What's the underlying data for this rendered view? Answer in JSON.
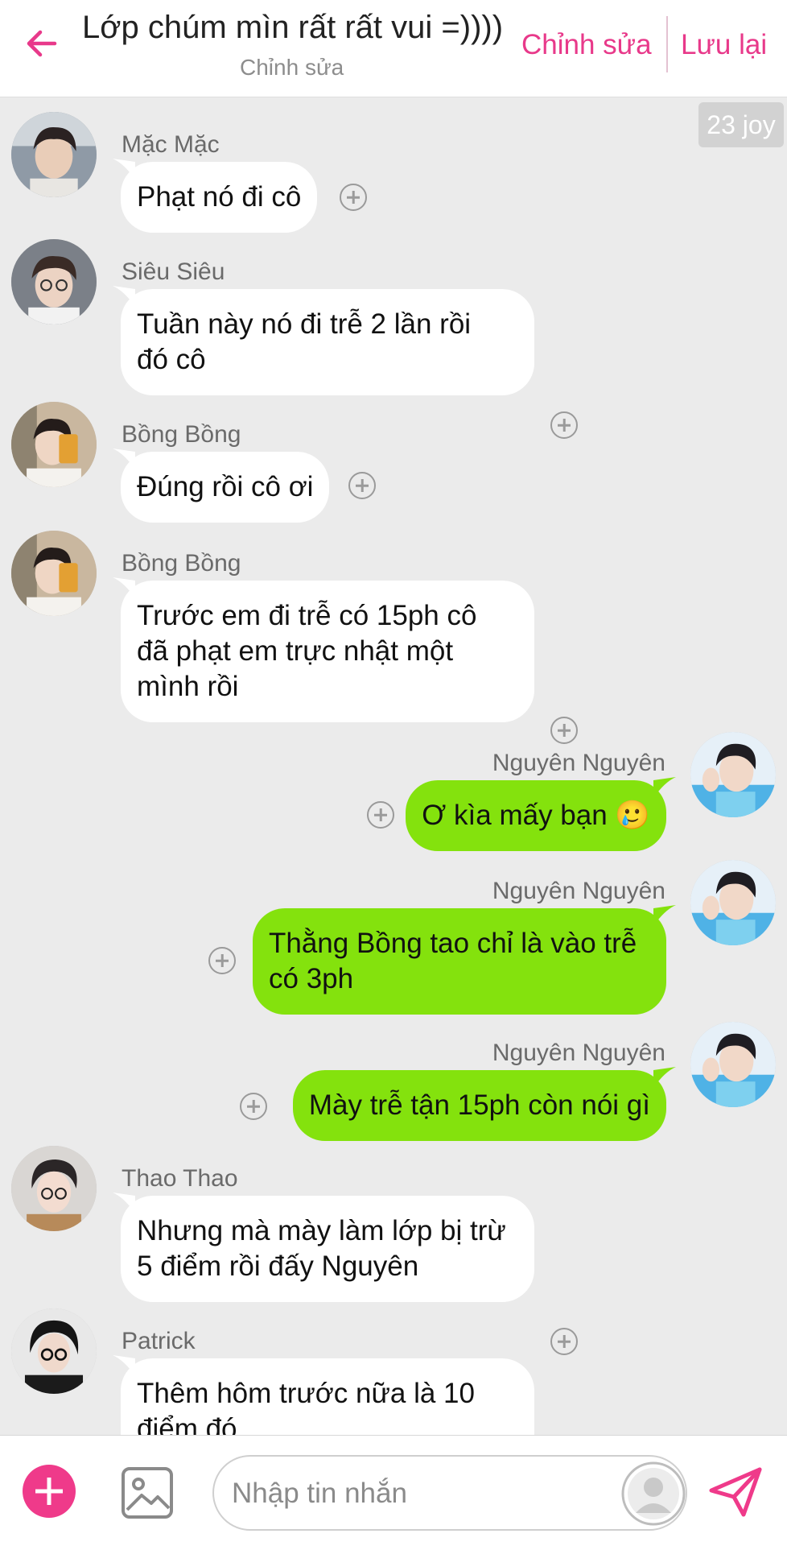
{
  "header": {
    "title": "Lớp chúm mìn rất rất vui =))))",
    "subtitle": "Chỉnh sửa",
    "edit_label": "Chỉnh sửa",
    "save_label": "Lưu lại",
    "accent_color": "#e8398a"
  },
  "chat": {
    "time_badge": "23 joy",
    "messages": [
      {
        "sender": "Mặc Mặc",
        "direction": "incoming",
        "lines": [
          "Phạt nó đi cô"
        ]
      },
      {
        "sender": "Siêu Siêu",
        "direction": "incoming",
        "lines": [
          "Tuần này nó đi trễ 2 lần rồi",
          "đó cô"
        ]
      },
      {
        "sender": "Bồng Bồng",
        "direction": "incoming",
        "lines": [
          "Đúng rồi cô ơi"
        ]
      },
      {
        "sender": "Bồng Bồng",
        "direction": "incoming",
        "lines": [
          "Trước em đi trễ có 15ph cô",
          "đã phạt em trực nhật một",
          "mình rồi"
        ]
      },
      {
        "sender": "Nguyên Nguyên",
        "direction": "outgoing",
        "lines": [
          "Ơ kìa mấy bạn 🥲"
        ]
      },
      {
        "sender": "Nguyên Nguyên",
        "direction": "outgoing",
        "lines": [
          "Thằng Bồng tao chỉ là vào trễ",
          "có 3ph"
        ]
      },
      {
        "sender": "Nguyên Nguyên",
        "direction": "outgoing",
        "lines": [
          "Mày trễ tận 15ph còn nói gì"
        ]
      },
      {
        "sender": "Thao Thao",
        "direction": "incoming",
        "lines": [
          "Nhưng mà mày làm lớp bị trừ",
          "5 điểm rồi đấy Nguyên"
        ]
      },
      {
        "sender": "Patrick",
        "direction": "incoming",
        "lines": [
          "Thêm hôm trước nữa là 10",
          "điểm đó"
        ]
      }
    ],
    "incoming_bubble_color": "#ffffff",
    "outgoing_bubble_color": "#84e20d"
  },
  "composer": {
    "placeholder": "Nhập tin nhắn",
    "add_icon": "plus-circle-icon",
    "image_icon": "image-icon",
    "send_icon": "send-icon"
  }
}
